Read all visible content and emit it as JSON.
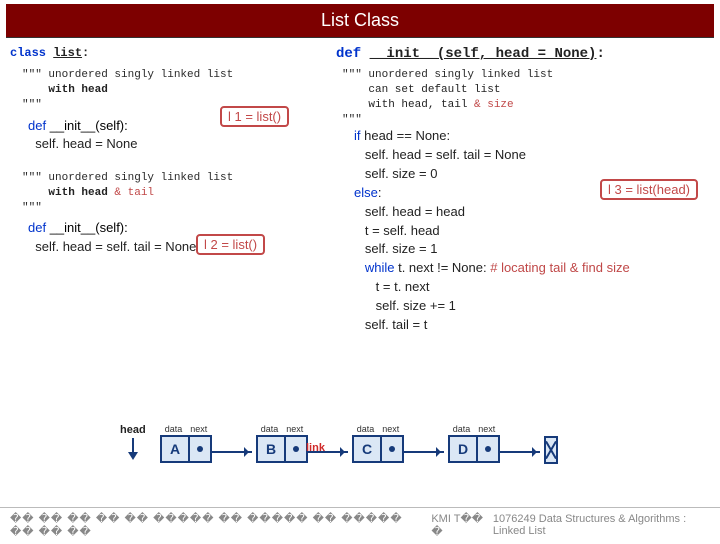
{
  "title": "List Class",
  "left": {
    "decl": {
      "kw": "class ",
      "name": "list",
      "suffix": ":"
    },
    "v1": {
      "doc_l1": "\"\"\" unordered singly linked list",
      "doc_l2": "with head",
      "doc_l3": "\"\"\"",
      "callout": "l 1 = list()",
      "def_kw": "def",
      "def_name": "__init__(self):",
      "body1": "self. head = None"
    },
    "v2": {
      "doc_l1": "\"\"\" unordered singly linked list",
      "doc_l2": "with head ",
      "doc_amp": "& tail",
      "doc_l3": "\"\"\"",
      "callout": "l 2 = list()",
      "def_kw": "def",
      "def_name": "__init__(self):",
      "body1": "self. head = self. tail = None"
    }
  },
  "right": {
    "def_line": {
      "kw": "def ",
      "name": "__init__(self, head = None)",
      "suffix": ":"
    },
    "doc_l1": "\"\"\" unordered singly linked list",
    "doc_l2": "can set default list",
    "doc_l3a": "with head, tail ",
    "doc_l3b": "& size",
    "doc_l4": "\"\"\"",
    "code": {
      "l1_kw": "if",
      "l1_rest": " head == None:",
      "l2": "self. head = self. tail = None",
      "l3": "self. size = 0",
      "l4_kw": "else",
      "l4_rest": ":",
      "l5": "self. head = head",
      "l6": "t = self. head",
      "l7": "self. size = 1",
      "l8_kw": "while",
      "l8_rest": " t. next != None:",
      "l8_comment": "   # locating tail & find size",
      "l9": "t = t. next",
      "l10": "self. size += 1",
      "l11": "self. tail = t"
    },
    "callout": "l 3 = list(head)"
  },
  "diagram": {
    "head_label": "head",
    "col_labels": {
      "data": "data",
      "next": "next"
    },
    "nodes": [
      "A",
      "B",
      "C",
      "D"
    ],
    "link_label": "link"
  },
  "footer": {
    "glyphs": "�� �� �� �� �� ����� �� ����� �� ����� �� �� ��",
    "mid": "KMI T�� �",
    "course": "1076249 Data Structures & Algorithms : Linked List"
  }
}
